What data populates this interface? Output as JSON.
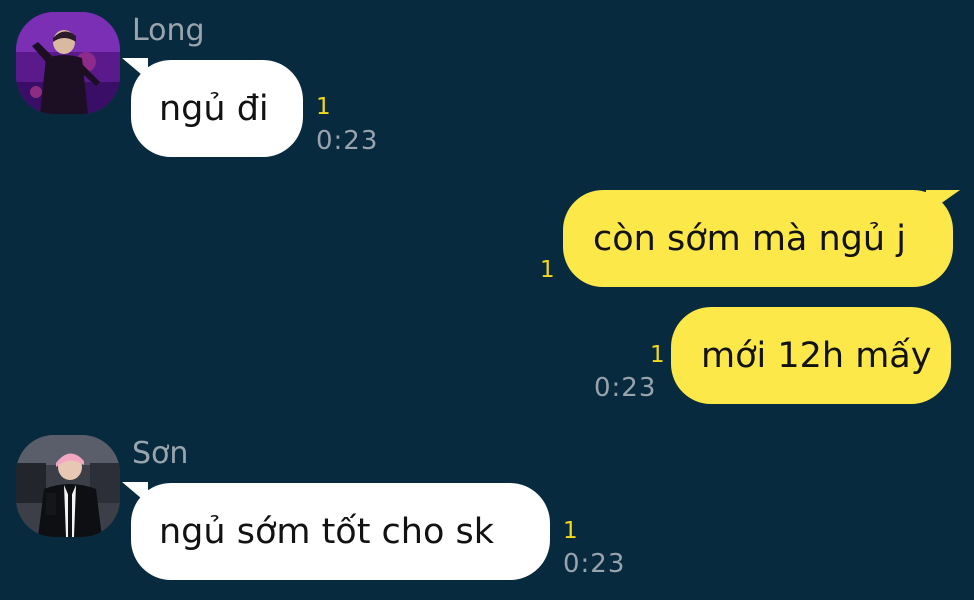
{
  "conversation": {
    "messages": [
      {
        "direction": "incoming",
        "sender": "Long",
        "avatar_icon": "purple-stage-performer-avatar",
        "text": "ngủ đi",
        "unread": "1",
        "time": "0:23"
      },
      {
        "direction": "outgoing",
        "text": "còn sớm mà ngủ j",
        "unread": "1",
        "time": ""
      },
      {
        "direction": "outgoing",
        "text": "mới 12h mấy",
        "unread": "1",
        "time": "0:23"
      },
      {
        "direction": "incoming",
        "sender": "Sơn",
        "avatar_icon": "pink-hair-suit-avatar",
        "text": "ngủ sớm tốt cho sk",
        "unread": "1",
        "time": "0:23"
      }
    ]
  },
  "colors": {
    "background": "#072a3e",
    "incoming_bubble": "#ffffff",
    "outgoing_bubble": "#fde84a",
    "unread_count": "#f4d81c",
    "meta_text": "#98a3ad"
  }
}
